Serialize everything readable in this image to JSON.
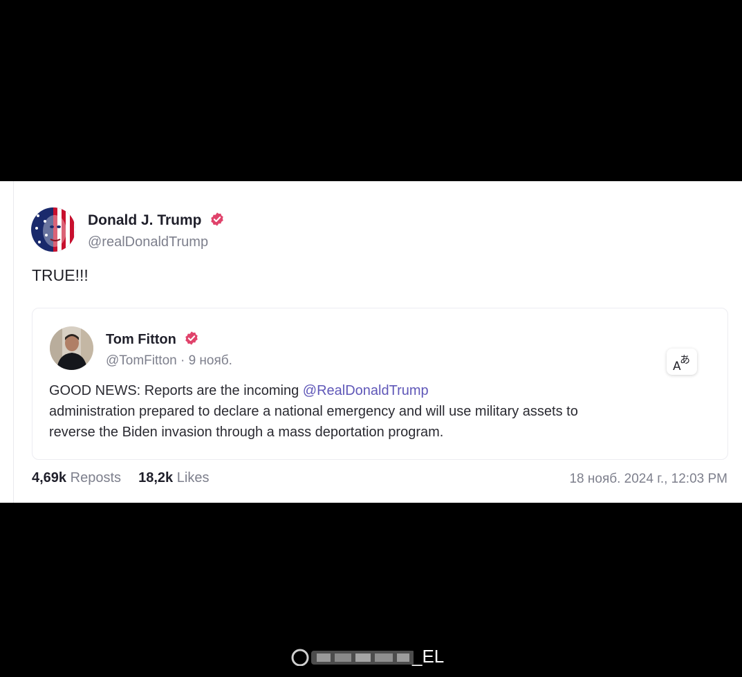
{
  "post": {
    "author_name": "Donald J. Trump",
    "author_handle": "@realDonaldTrump",
    "text": "TRUE!!!",
    "stats": {
      "reposts_count": "4,69k",
      "reposts_label": "Reposts",
      "likes_count": "18,2k",
      "likes_label": "Likes"
    },
    "date": "18 нояб. 2024 г., 12:03 PM"
  },
  "quote": {
    "author_name": "Tom Fitton",
    "author_handle": "@TomFitton · 9 нояб.",
    "body_line1_prefix": "GOOD NEWS: Reports are the incoming ",
    "body_line1_mention": "@RealDonaldTrump",
    "body_line2": " administration prepared to declare a national emergency and will use military assets to",
    "body_line3": "reverse the Biden invasion through a mass deportation program.",
    "translate_icon": "translate-icon"
  },
  "watermark": {
    "text": "_EL"
  },
  "colors": {
    "background": "#000000",
    "card": "#ffffff",
    "verified_badge": "#e0436b",
    "mention": "#5f57b8",
    "muted_text": "#7d7f8c"
  }
}
